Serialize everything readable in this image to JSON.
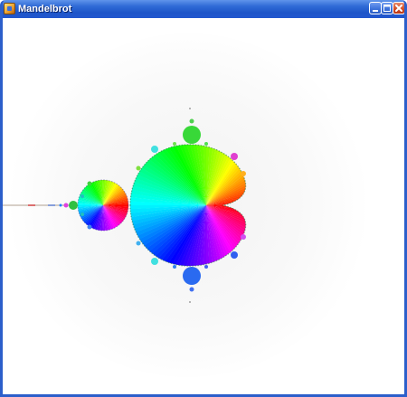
{
  "window": {
    "title": "Mandelbrot",
    "controls": {
      "minimize_icon": "minimize-icon",
      "maximize_icon": "maximize-icon",
      "close_icon": "close-icon"
    },
    "frame_color": "#2c5fcb",
    "titlebar_color": "#2f6ad6",
    "close_color": "#d14a22"
  },
  "canvas": {
    "content": "mandelbrot-set",
    "background": "#ffffff",
    "coloring": "rainbow-by-angle"
  }
}
